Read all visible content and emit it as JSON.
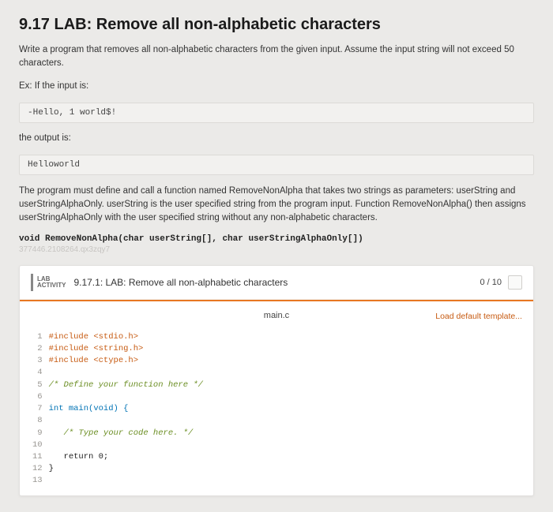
{
  "title": "9.17 LAB: Remove all non-alphabetic characters",
  "intro": "Write a program that removes all non-alphabetic characters from the given input. Assume the input string will not exceed 50 characters.",
  "ex_if_input": "Ex: If the input is:",
  "input_example": "-Hello, 1 world$!",
  "output_is": "the output is:",
  "output_example": "Helloworld",
  "para2_a": "The program must define and call a function named RemoveNonAlpha that takes two strings as parameters: userString and userStringAlphaOnly. userString is the user specified string from the program input. Function RemoveNonAlpha() then assigns userStringAlphaOnly with the user specified string without any non-alphabetic characters.",
  "decl": "void RemoveNonAlpha(char userString[], char userStringAlphaOnly[])",
  "faint_id": "377446.2108264.qx3zqy7",
  "lab_badge_line1": "LAB",
  "lab_badge_line2": "ACTIVITY",
  "activity_title": "9.17.1: LAB: Remove all non-alphabetic characters",
  "score": "0 / 10",
  "file_name": "main.c",
  "load_template": "Load default template...",
  "code_lines": {
    "l1": "#include <stdio.h>",
    "l2": "#include <string.h>",
    "l3": "#include <ctype.h>",
    "l4": "",
    "l5": "/* Define your function here */",
    "l6": "",
    "l7": "int main(void) {",
    "l8": "",
    "l9": "   /* Type your code here. */",
    "l10": "",
    "l11": "   return 0;",
    "l12": "}",
    "l13": ""
  },
  "chart_data": null
}
